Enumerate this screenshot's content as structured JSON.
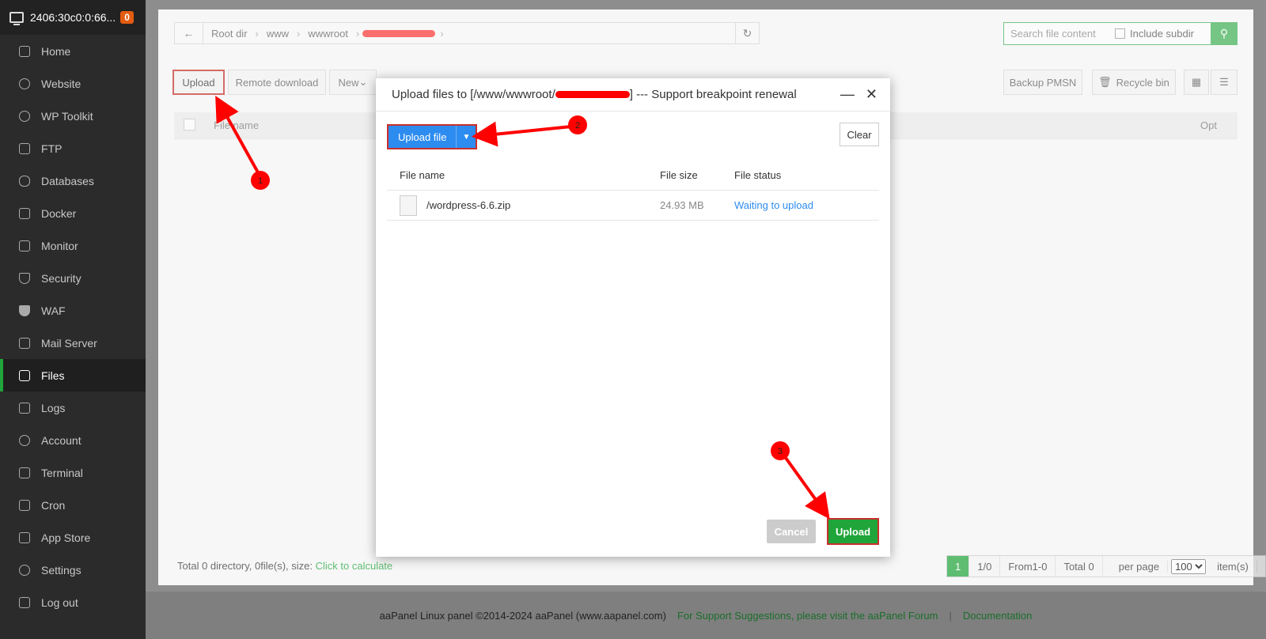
{
  "sidebar": {
    "host": "2406:30c0:0:66...",
    "badge": "0",
    "items": [
      {
        "label": "Home"
      },
      {
        "label": "Website"
      },
      {
        "label": "WP Toolkit"
      },
      {
        "label": "FTP"
      },
      {
        "label": "Databases"
      },
      {
        "label": "Docker"
      },
      {
        "label": "Monitor"
      },
      {
        "label": "Security"
      },
      {
        "label": "WAF"
      },
      {
        "label": "Mail Server"
      },
      {
        "label": "Files"
      },
      {
        "label": "Logs"
      },
      {
        "label": "Account"
      },
      {
        "label": "Terminal"
      },
      {
        "label": "Cron"
      },
      {
        "label": "App Store"
      },
      {
        "label": "Settings"
      },
      {
        "label": "Log out"
      }
    ]
  },
  "breadcrumb": {
    "root": "Root dir",
    "seg1": "www",
    "seg2": "wwwroot"
  },
  "search": {
    "placeholder": "Search file content",
    "subdir": "Include subdir"
  },
  "toolbar": {
    "upload": "Upload",
    "remote": "Remote download",
    "new": "New",
    "backup": "Backup PMSN",
    "recycle": "Recycle bin"
  },
  "table": {
    "name_header": "File name",
    "opt_header": "Opt"
  },
  "status_bar": {
    "summary": "Total 0 directory, 0file(s), size:",
    "calc": "Click to calculate"
  },
  "pager": {
    "current": "1",
    "pages": "1/0",
    "range": "From1-0",
    "total": "Total 0",
    "per_page": "per page",
    "per_page_value": "100",
    "items": "item(s)"
  },
  "footer": {
    "copyright": "aaPanel Linux panel ©2014-2024 aaPanel (www.aapanel.com)",
    "support": "For Support Suggestions, please visit the aaPanel Forum",
    "docs": "Documentation"
  },
  "dialog": {
    "title_prefix": "Upload files to [/www/wwwroot/",
    "title_suffix": "] --- Support breakpoint renewal",
    "upload_file": "Upload file",
    "clear": "Clear",
    "col_name": "File name",
    "col_size": "File size",
    "col_status": "File status",
    "files": [
      {
        "name": "/wordpress-6.6.zip",
        "size": "24.93 MB",
        "status": "Waiting to upload"
      }
    ],
    "cancel": "Cancel",
    "upload": "Upload"
  },
  "annotations": {
    "n1": "1",
    "n2": "2",
    "n3": "3",
    "color": "#ff0000"
  }
}
